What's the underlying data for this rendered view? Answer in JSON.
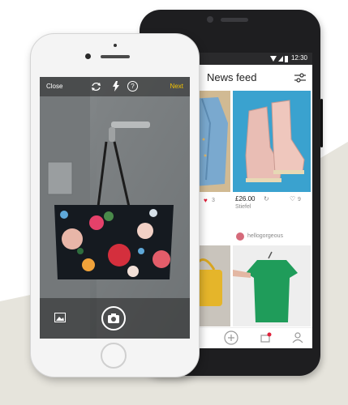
{
  "colors": {
    "accent_yellow": "#f5c400",
    "like_red": "#e0203a",
    "background_beige": "#e6e4dc"
  },
  "android": {
    "status_time": "12:30",
    "feed": {
      "title": "News feed",
      "items": [
        {
          "price": "£26.00",
          "brand": "Stiefel",
          "likes": "9",
          "liked": false
        },
        {
          "likes": "3",
          "liked": true
        }
      ],
      "seller": "hellogorgeous"
    },
    "nav_icons": [
      "search-icon",
      "plus-icon",
      "inbox-icon",
      "profile-icon"
    ]
  },
  "camera": {
    "close_label": "Close",
    "next_label": "Next",
    "top_icons": [
      "rotate-camera-icon",
      "flash-icon",
      "help-icon"
    ],
    "help_glyph": "?"
  }
}
